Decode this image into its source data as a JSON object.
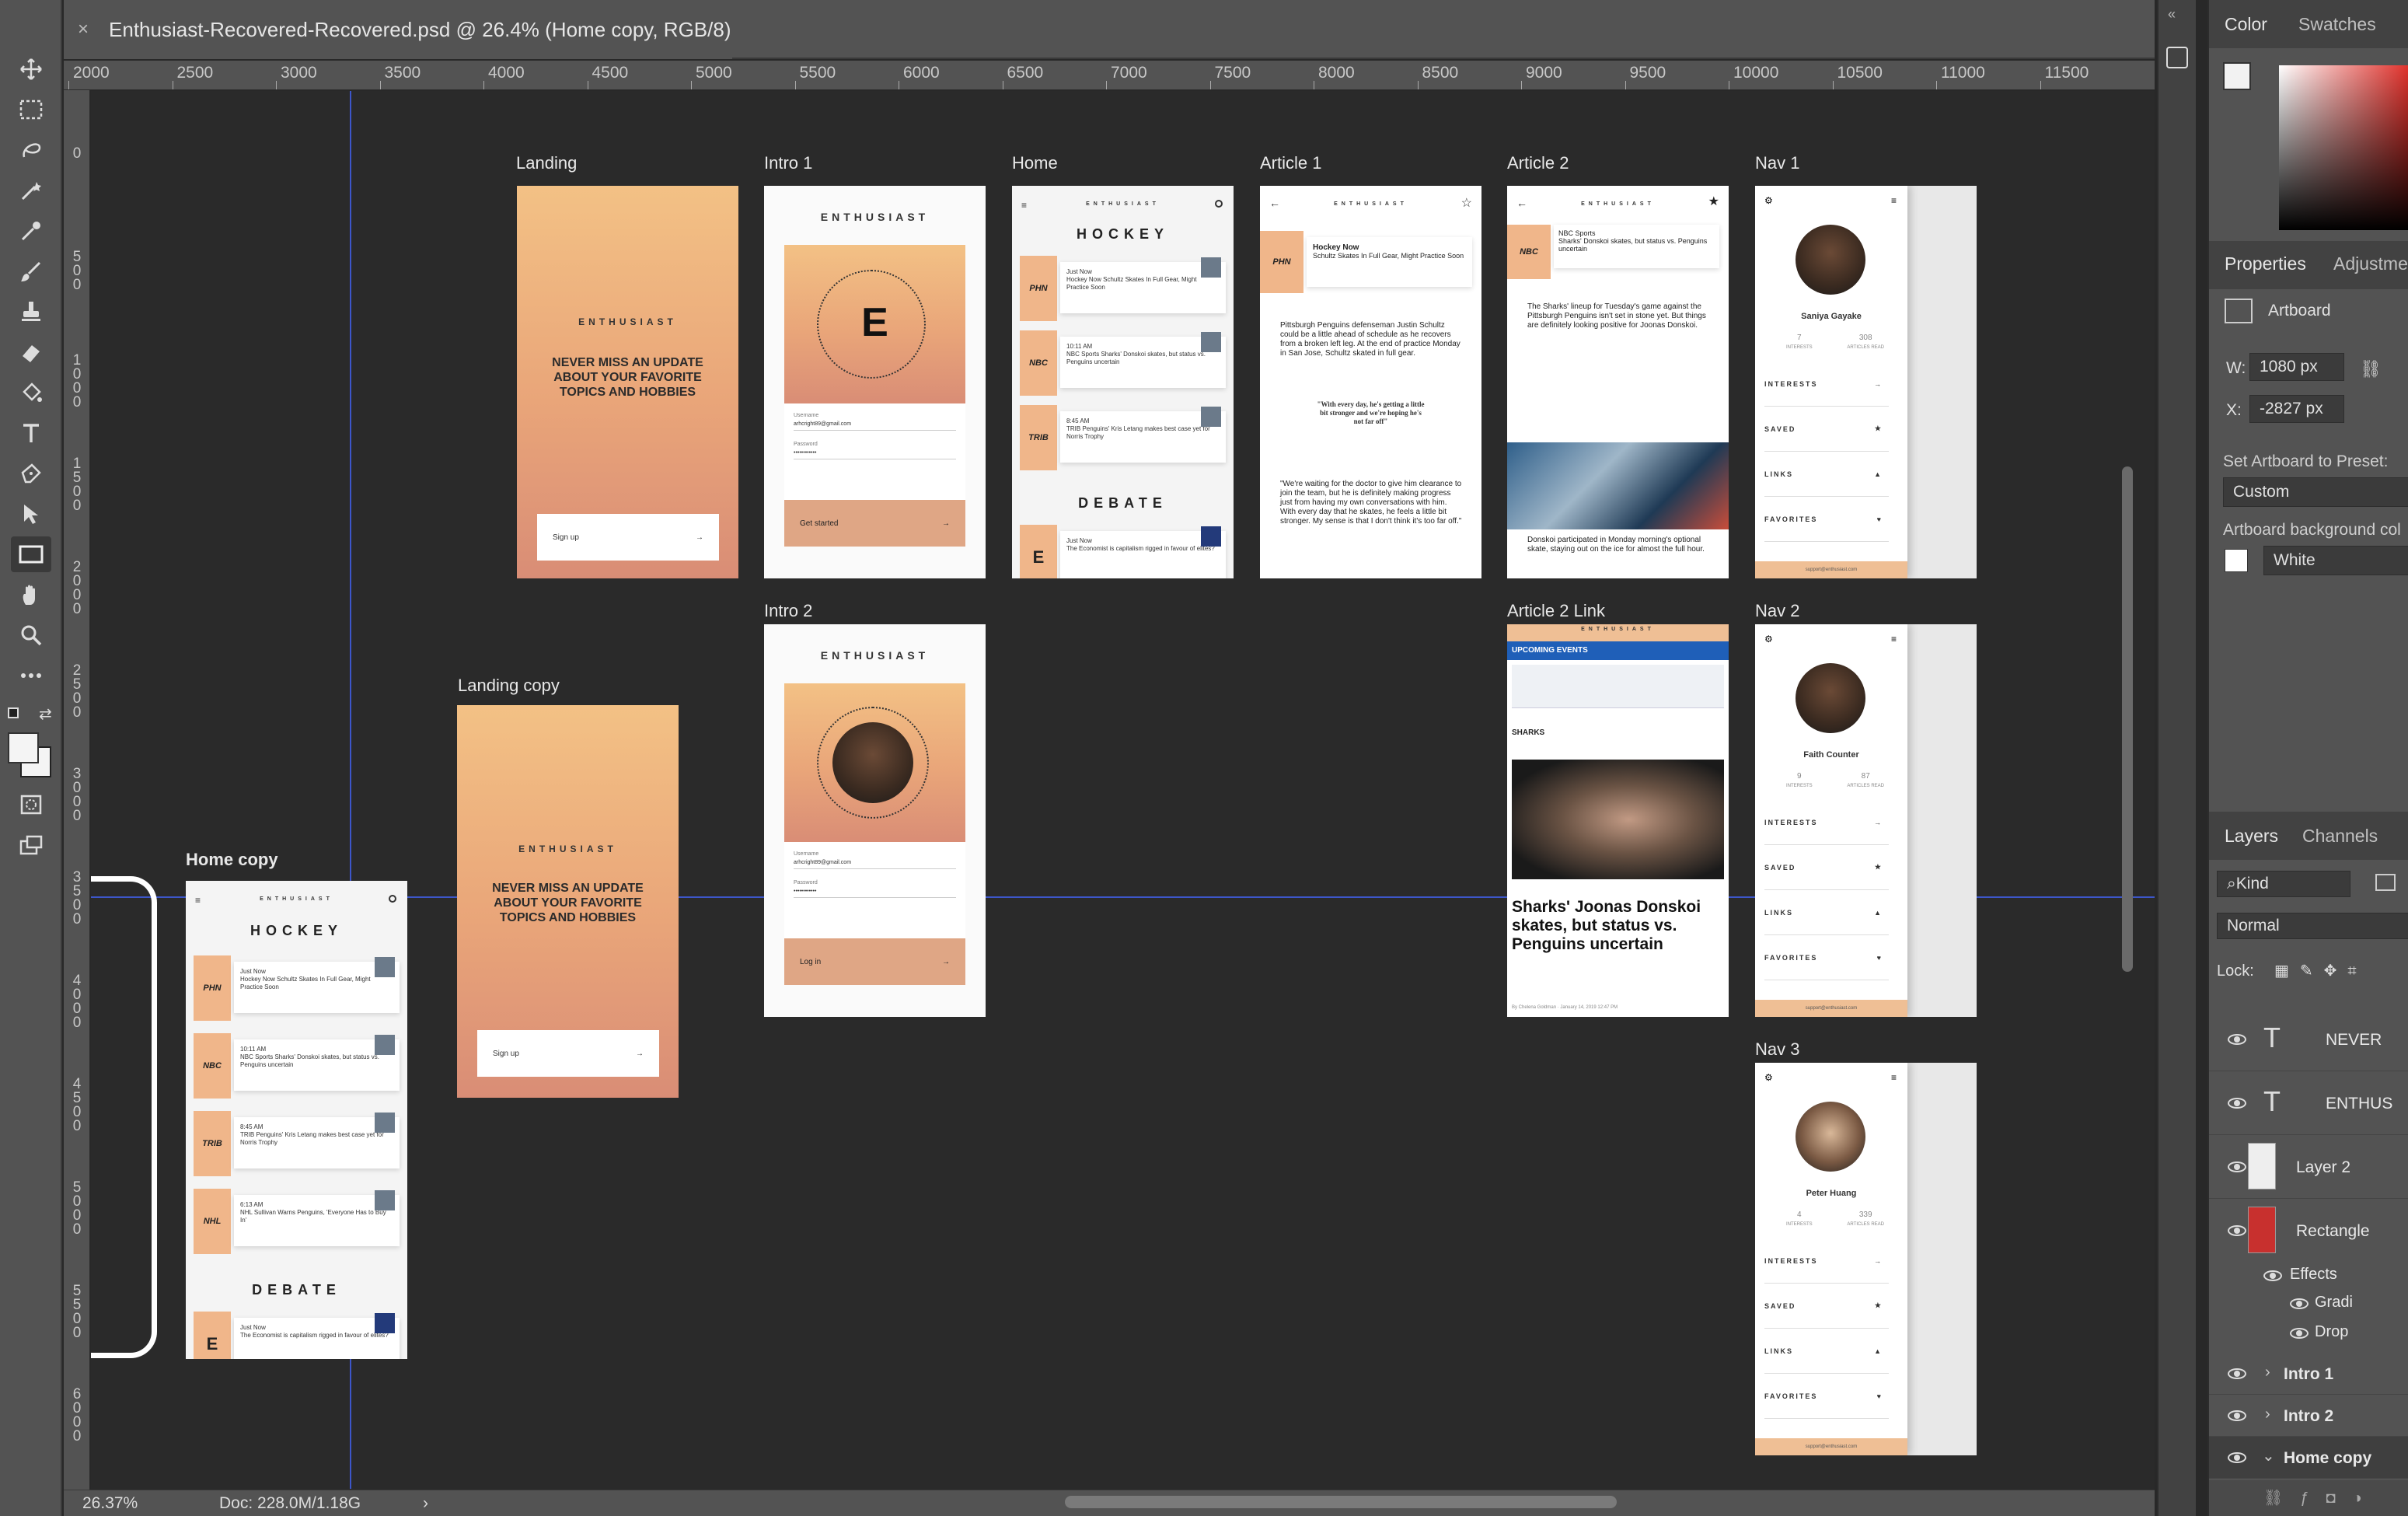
{
  "document": {
    "tab_title": "Enthusiast-Recovered-Recovered.psd @ 26.4% (Home copy, RGB/8)",
    "close_glyph": "×"
  },
  "tools": [
    "move-icon",
    "marquee-icon",
    "lasso-icon",
    "magic-wand-icon",
    "eyedropper-icon",
    "brush-icon",
    "stamp-icon",
    "eraser-icon",
    "paint-bucket-icon",
    "type-icon",
    "pen-icon",
    "path-select-icon",
    "rectangle-icon",
    "hand-icon",
    "zoom-icon",
    "more-icon"
  ],
  "ruler": {
    "top_labels": [
      "2000",
      "2500",
      "3000",
      "3500",
      "4000",
      "4500",
      "5000",
      "5500",
      "6000",
      "6500",
      "7000",
      "7500",
      "8000",
      "8500",
      "9000",
      "9500",
      "10000",
      "10500",
      "11000",
      "11500"
    ],
    "left_labels": [
      "500",
      "0",
      "500",
      "1000",
      "1500",
      "2000",
      "2500",
      "3000",
      "3500",
      "4000",
      "4500",
      "5000",
      "5500",
      "6000"
    ]
  },
  "artboards": {
    "landing": "Landing",
    "intro1": "Intro 1",
    "home": "Home",
    "article1": "Article 1",
    "article2": "Article 2",
    "nav1": "Nav 1",
    "intro2": "Intro 2",
    "article2link": "Article 2 Link",
    "nav2": "Nav 2",
    "landing_copy": "Landing copy",
    "home_copy": "Home copy",
    "nav3": "Nav 3"
  },
  "content": {
    "brand": "ENTHUSIAST",
    "tagline": "NEVER MISS AN UPDATE ABOUT YOUR FAVORITE TOPICS AND HOBBIES",
    "signup": "Sign up",
    "arrow": "→",
    "hockey": "HOCKEY",
    "debate": "DEBATE",
    "get_started": "Get started",
    "log_in": "Log in",
    "email_label": "Username",
    "email_value": "arhcright89@gmail.com",
    "password_label": "Password",
    "password_value": "••••••••••••",
    "e_logo": "E",
    "just_now": "Just Now",
    "phn": "PHN",
    "nbc": "NBC",
    "trib": "TRIB",
    "nhl": "NHL",
    "feed1": "Hockey Now Schultz Skates In Full Gear, Might Practice Soon",
    "feed2": "NBC Sports Sharks' Donskoi skates, but status vs. Penguins uncertain",
    "feed3": "TRIB Penguins' Kris Letang makes best case yet for Norris Trophy",
    "feed4": "NHL Sullivan Warns Penguins, 'Everyone Has to Buy In'",
    "feed5": "The Economist is capitalism rigged in favour of elites?",
    "t1": "10:11 AM",
    "t2": "8:45 AM",
    "t3": "6:13 AM",
    "article1_source": "Hockey Now",
    "article1_headline": "Schultz Skates In Full Gear, Might Practice Soon",
    "article1_body": "Pittsburgh Penguins defenseman Justin Schultz could be a little ahead of schedule as he recovers from a broken left leg. At the end of practice Monday in San Jose, Schultz skated in full gear.",
    "article1_quote": "\"With every day, he's getting a little bit stronger and we're hoping he's not far off\"",
    "article1_body2": "\"We're waiting for the doctor to give him clearance to join the team, but he is definitely making progress just from having my own conversations with him. With every day that he skates, he feels a little bit stronger. My sense is that I don't think it's too far off.\"",
    "article2_source": "NBC Sports",
    "article2_headline": "Sharks' Donskoi skates, but status vs. Penguins uncertain",
    "article2_body": "The Sharks' lineup for Tuesday's game against the Pittsburgh Penguins isn't set in stone yet. But things are definitely looking positive for Joonas Donskoi.",
    "article2_body2": "Donskoi participated in Monday morning's optional skate, staying out on the ice for almost the full hour.",
    "link_upcoming": "UPCOMING EVENTS",
    "link_sharks": "SHARKS",
    "link_headline": "Sharks' Joonas Donskoi skates, but status vs. Penguins uncertain",
    "link_byline": "By Chelena Goldman · January 14, 2019 12:47 PM",
    "nav_interests": "INTERESTS",
    "nav_saved": "SAVED",
    "nav_links": "LINKS",
    "nav_favorites": "FAVORITES",
    "nav_interests_label": "INTERESTS",
    "nav_articles_label": "ARTICLES READ",
    "nav1_name": "Saniya Gayake",
    "nav1_interests": "7",
    "nav1_articles": "308",
    "nav2_name": "Faith Counter",
    "nav2_interests": "9",
    "nav2_articles": "87",
    "nav3_name": "Peter Huang",
    "nav3_interests": "4",
    "nav3_articles": "339",
    "support": "support@enthusiast.com"
  },
  "panels": {
    "color_tab": "Color",
    "swatches_tab": "Swatches",
    "properties_tab": "Properties",
    "adjustments_tab": "Adjustme",
    "artboard_label": "Artboard",
    "w_label": "W:",
    "w_value": "1080 px",
    "x_label": "X:",
    "x_value": "-2827 px",
    "preset_label": "Set Artboard to Preset:",
    "preset_value": "Custom",
    "bg_label": "Artboard background col",
    "bg_value": "White",
    "layers_tab": "Layers",
    "channels_tab": "Channels",
    "kind": "Kind",
    "blend": "Normal",
    "lock": "Lock:",
    "layers": [
      {
        "name": "NEVER",
        "type": "text"
      },
      {
        "name": "ENTHUS",
        "type": "text"
      },
      {
        "name": "Layer 2",
        "type": "pixel"
      },
      {
        "name": "Rectangle",
        "type": "shape"
      }
    ],
    "effects": "Effects",
    "gradient": "Gradi",
    "drop": "Drop",
    "groups": [
      "Intro 1",
      "Intro 2",
      "Home copy"
    ]
  },
  "status": {
    "zoom": "26.37%",
    "doc": "Doc: 228.0M/1.18G",
    "arrow": "›"
  },
  "colors": {
    "accent_guide": "#3d56c9",
    "gradient_top": "#f3c185",
    "gradient_bottom": "#d98d76",
    "rect_swatch": "#c8302e"
  }
}
